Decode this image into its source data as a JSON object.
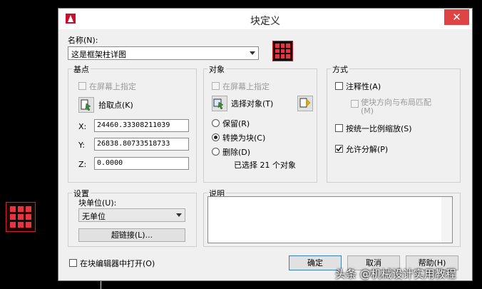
{
  "dialog": {
    "title": "块定义",
    "close": "✕",
    "name_label": "名称(N):",
    "name_value": "这是框架柱详图"
  },
  "base_point": {
    "legend": "基点",
    "specify_on_screen": "在屏幕上指定",
    "pick_point": "拾取点(K)",
    "x_label": "X:",
    "x_value": "24460.33308211039",
    "y_label": "Y:",
    "y_value": "26838.80733518733",
    "z_label": "Z:",
    "z_value": "0.0000"
  },
  "objects": {
    "legend": "对象",
    "specify_on_screen": "在屏幕上指定",
    "select_objects": "选择对象(T)",
    "retain": "保留(R)",
    "convert_to_block": "转换为块(C)",
    "delete": "删除(D)",
    "selected_count": "已选择 21 个对象",
    "selected_option": "convert_to_block"
  },
  "behavior": {
    "legend": "方式",
    "annotative": "注释性(A)",
    "match_orientation": "使块方向与布局匹配(M)",
    "scale_uniformly": "按统一比例缩放(S)",
    "allow_exploding": "允许分解(P)",
    "annotative_checked": false,
    "scale_uniformly_checked": false,
    "allow_exploding_checked": true
  },
  "settings": {
    "legend": "设置",
    "block_unit_label": "块单位(U):",
    "block_unit_value": "无单位",
    "hyperlink": "超链接(L)..."
  },
  "description": {
    "legend": "说明",
    "value": ""
  },
  "footer": {
    "open_in_editor": "在块编辑器中打开(O)",
    "ok": "确定",
    "cancel": "取消",
    "help": "帮助(H)"
  },
  "watermark": "头条 @机械设计实用教程",
  "colors": {
    "accent_red": "#e8353d",
    "close_red": "#e04343",
    "default_border": "#3c7fb1"
  }
}
